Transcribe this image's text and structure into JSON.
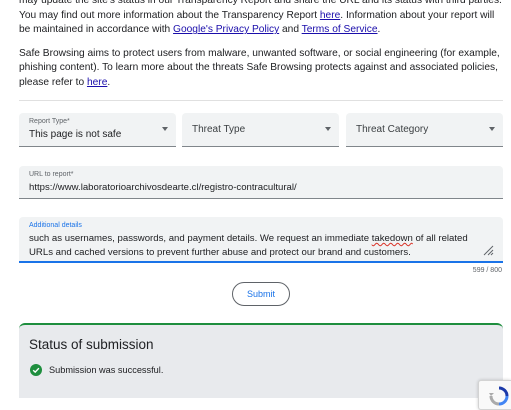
{
  "intro": {
    "p1_a": "may update the site's status in our Transparency Report and share the URL and its status with third parties. You may find out more information about the Transparency Report ",
    "p1_link1": "here",
    "p1_b": ". Information about your report will be maintained in accordance with ",
    "p1_link2": "Google's Privacy Policy",
    "p1_c": " and ",
    "p1_link3": "Terms of Service",
    "p1_d": ".",
    "p2_a": "Safe Browsing aims to protect users from malware, unwanted software, or social engineering (for example, phishing content). To learn more about the threats Safe Browsing protects against and associated policies, please refer to ",
    "p2_link": "here",
    "p2_b": "."
  },
  "form": {
    "report_type": {
      "label": "Report Type*",
      "value": "This page is not safe"
    },
    "threat_type": {
      "placeholder": "Threat Type"
    },
    "threat_category": {
      "placeholder": "Threat Category"
    },
    "url": {
      "label": "URL to report*",
      "value": "https://www.laboratorioarchivosdearte.cl/registro-contracultural/"
    },
    "details": {
      "label": "Additional details",
      "line1_a": "such as usernames, passwords, and payment details. We request an immediate ",
      "line1_misspelled": "takedown",
      "line1_b": " of all related",
      "line2": "URLs and cached versions to prevent further abuse and protect our brand and customers."
    },
    "counter": "599 / 800",
    "submit_label": "Submit"
  },
  "status": {
    "title": "Status of submission",
    "message": "Submission was successful."
  },
  "colors": {
    "accent": "#1a73e8",
    "success": "#1e8e3e",
    "link": "#1a0dab",
    "field_bg": "#f1f3f4"
  },
  "icons": {
    "select_caret": "caret-down-icon",
    "resize": "resize-handle-icon",
    "success": "check-circle-icon",
    "recaptcha": "recaptcha-logo-icon"
  }
}
